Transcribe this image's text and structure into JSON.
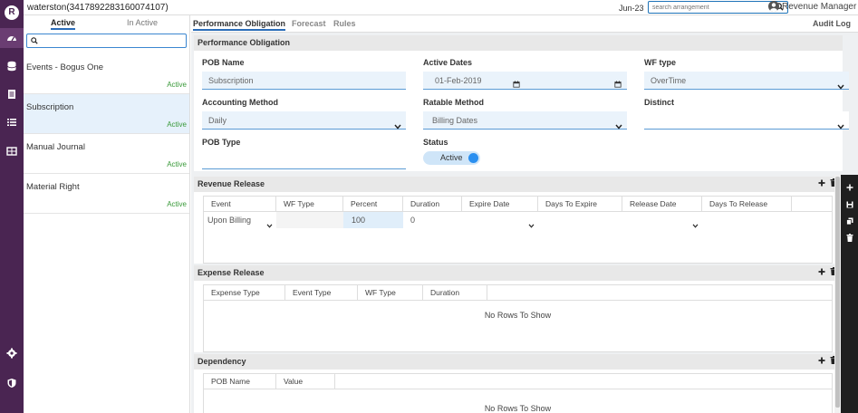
{
  "app": {
    "logo_letter": "R",
    "arrangement_title": "waterston(3417892283160074107)",
    "period": "Jun-23",
    "search_placeholder": "search arrangement",
    "user_name": "Revenue Manager"
  },
  "list": {
    "tabs": [
      "Active",
      "In Active"
    ],
    "filter_value": "",
    "items": [
      {
        "name": "Events - Bogus One",
        "status": "Active"
      },
      {
        "name": "Subscription",
        "status": "Active"
      },
      {
        "name": "Manual Journal",
        "status": "Active"
      },
      {
        "name": "Material Right",
        "status": "Active"
      }
    ]
  },
  "main": {
    "tabs": [
      "Performance Obligation",
      "Forecast",
      "Rules"
    ],
    "audit_log": "Audit Log"
  },
  "pob": {
    "section_title": "Performance Obligation",
    "pob_name_label": "POB Name",
    "pob_name_value": "Subscription",
    "active_dates_label": "Active Dates",
    "active_dates_start": "01-Feb-2019",
    "active_dates_end": "",
    "wf_type_label": "WF type",
    "wf_type_value": "OverTime",
    "accounting_method_label": "Accounting Method",
    "accounting_method_value": "Daily",
    "ratable_method_label": "Ratable Method",
    "ratable_method_value": "Billing Dates",
    "distinct_label": "Distinct",
    "distinct_value": "",
    "pob_type_label": "POB Type",
    "pob_type_value": "",
    "status_label": "Status",
    "status_value": "Active"
  },
  "revenue_release": {
    "title": "Revenue Release",
    "columns": [
      "Event",
      "WF Type",
      "Percent",
      "Duration",
      "Expire Date",
      "Days To Expire",
      "Release Date",
      "Days To Release"
    ],
    "row": {
      "event": "Upon Billing",
      "wf_type": "",
      "percent": "100",
      "duration": "0",
      "expire_date": "",
      "days_to_expire": "",
      "release_date": "",
      "days_to_release": ""
    }
  },
  "expense_release": {
    "title": "Expense Release",
    "columns": [
      "Expense Type",
      "Event Type",
      "WF Type",
      "Duration"
    ],
    "empty_text": "No Rows To Show"
  },
  "dependency": {
    "title": "Dependency",
    "columns": [
      "POB Name",
      "Value"
    ],
    "empty_text": "No Rows To Show"
  },
  "icons": [
    "dashboard-icon",
    "database-icon",
    "document-icon",
    "list-icon",
    "table-icon",
    "settings-icon",
    "shield-icon",
    "search-icon",
    "user-avatar-icon",
    "plus-icon",
    "trash-icon",
    "save-icon",
    "copy-icon",
    "calendar-icon",
    "chevron-down-icon"
  ],
  "colors": {
    "nav_bg": "#4a2552",
    "accent": "#2a6cb8",
    "active_green": "#3a9a3a",
    "toggle_knob": "#2a8ff0"
  }
}
